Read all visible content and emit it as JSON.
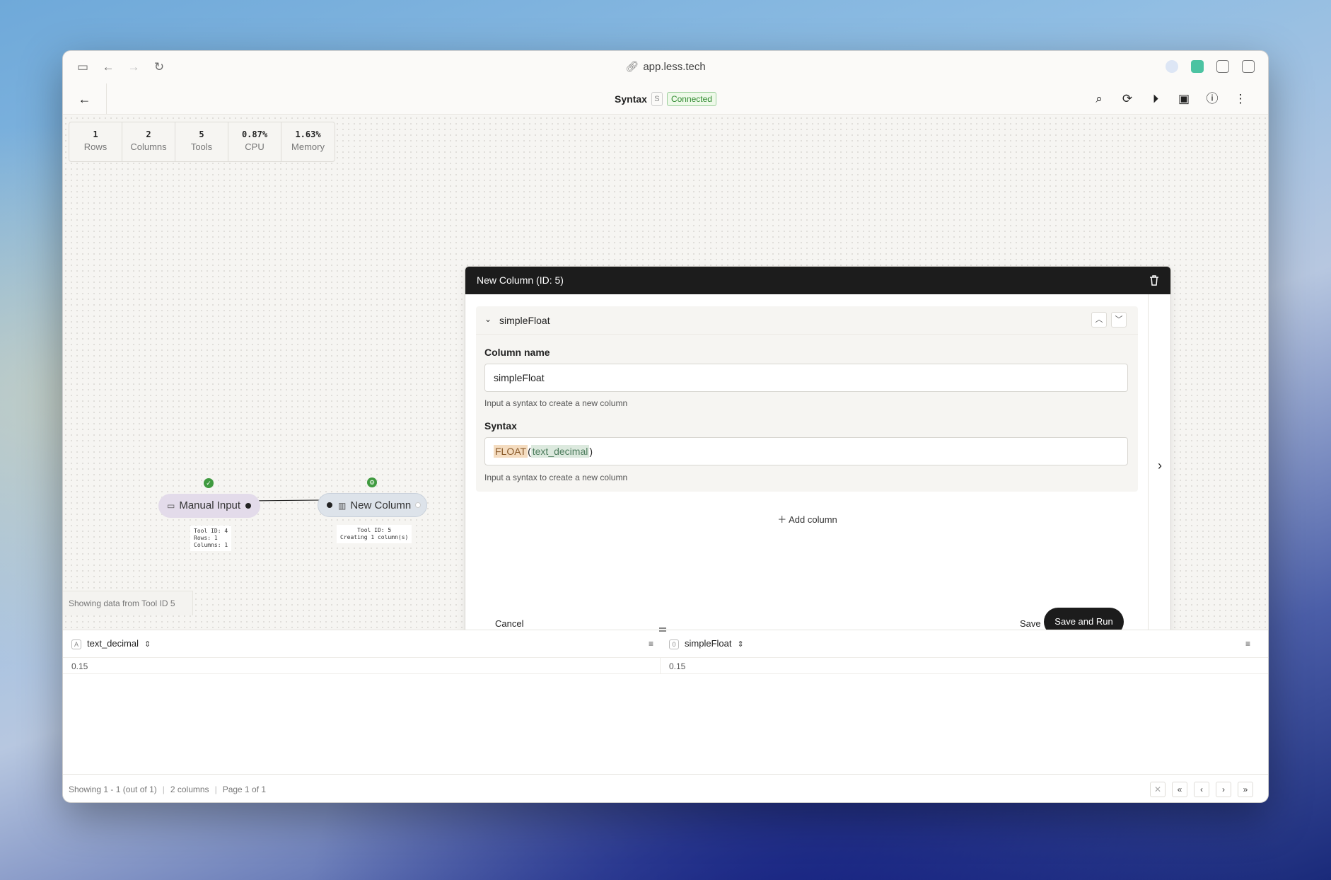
{
  "browser": {
    "url": "app.less.tech"
  },
  "header": {
    "title": "Syntax",
    "shortcut": "S",
    "status": "Connected"
  },
  "stats": [
    {
      "value": "1",
      "label": "Rows"
    },
    {
      "value": "2",
      "label": "Columns"
    },
    {
      "value": "5",
      "label": "Tools"
    },
    {
      "value": "0.87%",
      "label": "CPU"
    },
    {
      "value": "1.63%",
      "label": "Memory"
    }
  ],
  "nodes": {
    "manual_input": {
      "label": "Manual Input",
      "meta": [
        "Tool ID: 4",
        "Rows: 1",
        "Columns: 1"
      ]
    },
    "new_column": {
      "label": "New Column",
      "meta": [
        "Tool ID: 5",
        "Creating 1 column(s)"
      ]
    }
  },
  "canvas": {
    "showing_label": "Showing data from Tool ID 5"
  },
  "dialog": {
    "title": "New Column (ID: 5)",
    "section_name": "simpleFloat",
    "column_name_label": "Column name",
    "column_name_value": "simpleFloat",
    "column_name_help": "Input a syntax to create a new column",
    "syntax_label": "Syntax",
    "syntax_fn": "FLOAT",
    "syntax_open": "(",
    "syntax_arg": "text_decimal",
    "syntax_close": ")",
    "syntax_help": "Input a syntax to create a new column",
    "add_column": "Add column",
    "cancel": "Cancel",
    "save": "Save",
    "save_and_run": "Save and Run"
  },
  "table": {
    "columns": [
      {
        "name": "text_decimal",
        "type_icon": "A"
      },
      {
        "name": "simpleFloat",
        "type_icon": "0"
      }
    ],
    "rows": [
      [
        "0.15",
        "0.15"
      ]
    ],
    "footer": {
      "showing": "Showing 1 - 1 (out of 1)",
      "columns": "2 columns",
      "page": "Page 1 of 1"
    }
  }
}
